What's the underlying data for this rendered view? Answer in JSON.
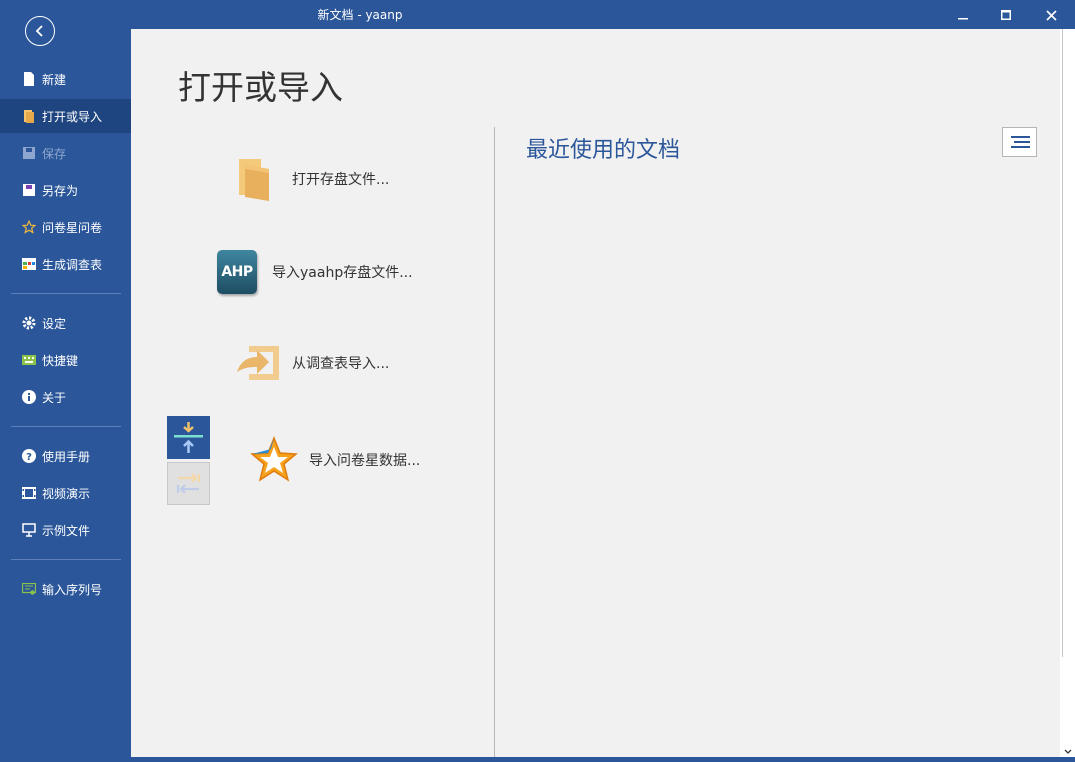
{
  "window": {
    "title": "新文档 - yaanp"
  },
  "sidebar": {
    "items": [
      {
        "label": "新建"
      },
      {
        "label": "打开或导入"
      },
      {
        "label": "保存"
      },
      {
        "label": "另存为"
      },
      {
        "label": "问卷星问卷"
      },
      {
        "label": "生成调查表"
      },
      {
        "label": "设定"
      },
      {
        "label": "快捷键"
      },
      {
        "label": "关于"
      },
      {
        "label": "使用手册"
      },
      {
        "label": "视频演示"
      },
      {
        "label": "示例文件"
      },
      {
        "label": "输入序列号"
      }
    ]
  },
  "main": {
    "heading": "打开或导入",
    "actions": [
      {
        "label": "打开存盘文件..."
      },
      {
        "label": "导入yaahp存盘文件...",
        "badge": "AHP"
      },
      {
        "label": "从调查表导入..."
      },
      {
        "label": "导入问卷星数据..."
      }
    ],
    "recent_title": "最近使用的文档"
  },
  "colors": {
    "accent": "#2b579a",
    "sidebar_active": "#1e4580",
    "panel_bg": "#f1f1f1"
  }
}
